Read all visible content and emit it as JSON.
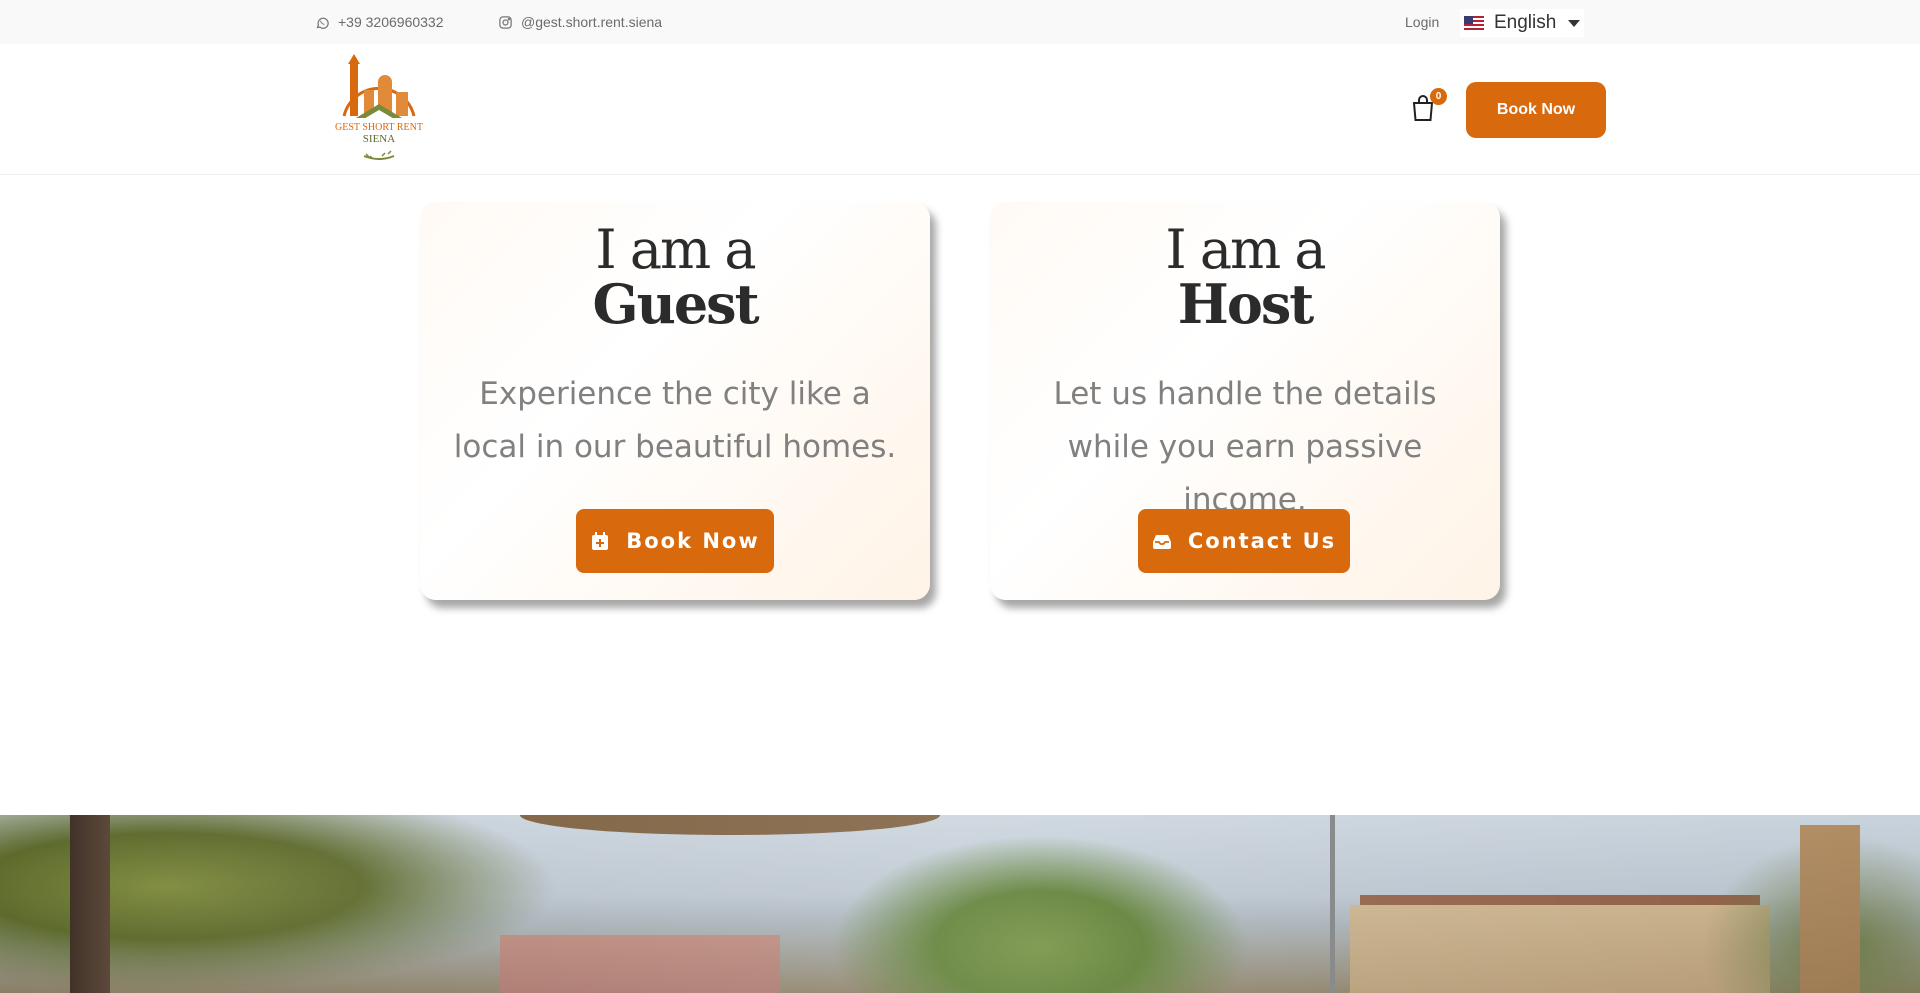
{
  "topbar": {
    "phone": "+39 3206960332",
    "instagram": "@gest.short.rent.siena",
    "login_label": "Login",
    "language": "English"
  },
  "header": {
    "logo_line1": "GEST SHORT RENT",
    "logo_line2": "SIENA",
    "cart_count": "0",
    "book_now_label": "Book Now"
  },
  "cards": {
    "guest": {
      "lead": "I am a",
      "role": "Guest",
      "description": "Experience the city like a local in our beautiful homes.",
      "button_label": "Book Now",
      "button_icon": "calendar-plus-icon"
    },
    "host": {
      "lead": "I am a",
      "role": "Host",
      "description": "Let us handle the details while you earn passive income.",
      "button_label": "Contact Us",
      "button_icon": "inbox-icon"
    }
  },
  "colors": {
    "accent": "#d8690c",
    "text_dark": "#2b2b2b",
    "text_muted": "#808080"
  }
}
